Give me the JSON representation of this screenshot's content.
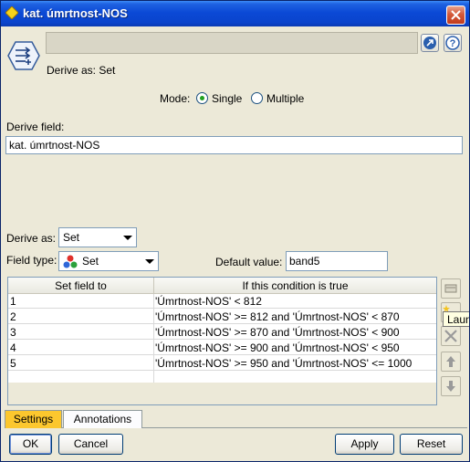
{
  "window": {
    "title": "kat. úmrtnost-NOS",
    "header_subtitle": "Derive as: Set"
  },
  "icons": {
    "title_icon": "diamond-node-icon",
    "node_icon": "derive-node-icon",
    "help_icon": "help-icon",
    "launch_icon": "launch-icon",
    "close_icon": "close-icon"
  },
  "mode": {
    "label": "Mode:",
    "options": [
      "Single",
      "Multiple"
    ],
    "selected": "Single"
  },
  "derive_field": {
    "label": "Derive field:",
    "value": "kat. úmrtnost-NOS"
  },
  "derive_as": {
    "label": "Derive as:",
    "value": "Set"
  },
  "field_type": {
    "label": "Field type:",
    "value": "Set"
  },
  "default_value": {
    "label": "Default value:",
    "value": "band5"
  },
  "table": {
    "headers": [
      "Set field to",
      "If this condition is true"
    ],
    "rows": [
      {
        "value": "1",
        "condition": "'Úmrtnost-NOS' < 812"
      },
      {
        "value": "2",
        "condition": "'Úmrtnost-NOS' >= 812 and 'Úmrtnost-NOS' < 870"
      },
      {
        "value": "3",
        "condition": "'Úmrtnost-NOS' >= 870 and 'Úmrtnost-NOS' < 900"
      },
      {
        "value": "4",
        "condition": "'Úmrtnost-NOS' >= 900 and 'Úmrtnost-NOS' < 950"
      },
      {
        "value": "5",
        "condition": "'Úmrtnost-NOS' >= 950 and 'Úmrtnost-NOS' <= 1000"
      }
    ]
  },
  "tooltip": "Laun",
  "tabs": [
    "Settings",
    "Annotations"
  ],
  "buttons": {
    "ok": "OK",
    "cancel": "Cancel",
    "apply": "Apply",
    "reset": "Reset"
  },
  "colors": {
    "titlebar": "#0a44cc",
    "active_tab": "#fcc72e",
    "radio_dot": "#21a121"
  }
}
